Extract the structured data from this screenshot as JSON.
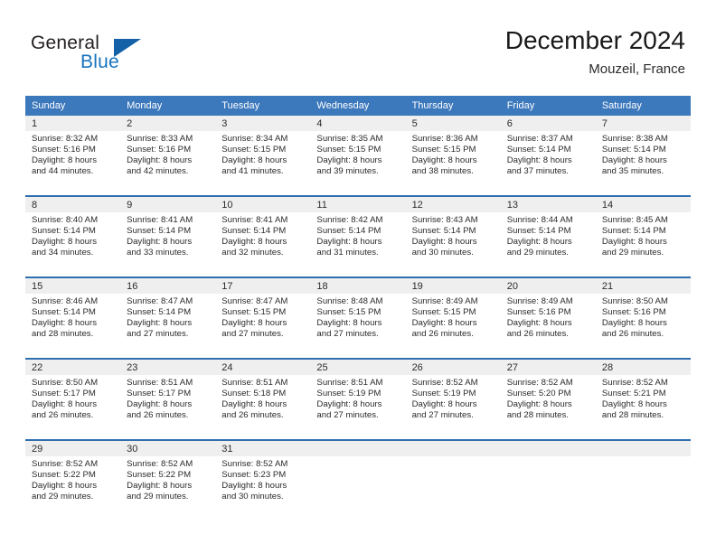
{
  "brand": {
    "name_top": "General",
    "name_bottom": "Blue",
    "accent_color": "#1673bd",
    "triangle_color": "#1461a8"
  },
  "header": {
    "title": "December 2024",
    "subtitle": "Mouzeil, France"
  },
  "calendar": {
    "header_bg": "#3c78bc",
    "row_separator_color": "#2f6fb0",
    "daynum_band_bg": "#efefef",
    "weekday_headers": [
      "Sunday",
      "Monday",
      "Tuesday",
      "Wednesday",
      "Thursday",
      "Friday",
      "Saturday"
    ],
    "weeks": [
      [
        {
          "day": "1",
          "sunrise": "Sunrise: 8:32 AM",
          "sunset": "Sunset: 5:16 PM",
          "daylight1": "Daylight: 8 hours",
          "daylight2": "and 44 minutes."
        },
        {
          "day": "2",
          "sunrise": "Sunrise: 8:33 AM",
          "sunset": "Sunset: 5:16 PM",
          "daylight1": "Daylight: 8 hours",
          "daylight2": "and 42 minutes."
        },
        {
          "day": "3",
          "sunrise": "Sunrise: 8:34 AM",
          "sunset": "Sunset: 5:15 PM",
          "daylight1": "Daylight: 8 hours",
          "daylight2": "and 41 minutes."
        },
        {
          "day": "4",
          "sunrise": "Sunrise: 8:35 AM",
          "sunset": "Sunset: 5:15 PM",
          "daylight1": "Daylight: 8 hours",
          "daylight2": "and 39 minutes."
        },
        {
          "day": "5",
          "sunrise": "Sunrise: 8:36 AM",
          "sunset": "Sunset: 5:15 PM",
          "daylight1": "Daylight: 8 hours",
          "daylight2": "and 38 minutes."
        },
        {
          "day": "6",
          "sunrise": "Sunrise: 8:37 AM",
          "sunset": "Sunset: 5:14 PM",
          "daylight1": "Daylight: 8 hours",
          "daylight2": "and 37 minutes."
        },
        {
          "day": "7",
          "sunrise": "Sunrise: 8:38 AM",
          "sunset": "Sunset: 5:14 PM",
          "daylight1": "Daylight: 8 hours",
          "daylight2": "and 35 minutes."
        }
      ],
      [
        {
          "day": "8",
          "sunrise": "Sunrise: 8:40 AM",
          "sunset": "Sunset: 5:14 PM",
          "daylight1": "Daylight: 8 hours",
          "daylight2": "and 34 minutes."
        },
        {
          "day": "9",
          "sunrise": "Sunrise: 8:41 AM",
          "sunset": "Sunset: 5:14 PM",
          "daylight1": "Daylight: 8 hours",
          "daylight2": "and 33 minutes."
        },
        {
          "day": "10",
          "sunrise": "Sunrise: 8:41 AM",
          "sunset": "Sunset: 5:14 PM",
          "daylight1": "Daylight: 8 hours",
          "daylight2": "and 32 minutes."
        },
        {
          "day": "11",
          "sunrise": "Sunrise: 8:42 AM",
          "sunset": "Sunset: 5:14 PM",
          "daylight1": "Daylight: 8 hours",
          "daylight2": "and 31 minutes."
        },
        {
          "day": "12",
          "sunrise": "Sunrise: 8:43 AM",
          "sunset": "Sunset: 5:14 PM",
          "daylight1": "Daylight: 8 hours",
          "daylight2": "and 30 minutes."
        },
        {
          "day": "13",
          "sunrise": "Sunrise: 8:44 AM",
          "sunset": "Sunset: 5:14 PM",
          "daylight1": "Daylight: 8 hours",
          "daylight2": "and 29 minutes."
        },
        {
          "day": "14",
          "sunrise": "Sunrise: 8:45 AM",
          "sunset": "Sunset: 5:14 PM",
          "daylight1": "Daylight: 8 hours",
          "daylight2": "and 29 minutes."
        }
      ],
      [
        {
          "day": "15",
          "sunrise": "Sunrise: 8:46 AM",
          "sunset": "Sunset: 5:14 PM",
          "daylight1": "Daylight: 8 hours",
          "daylight2": "and 28 minutes."
        },
        {
          "day": "16",
          "sunrise": "Sunrise: 8:47 AM",
          "sunset": "Sunset: 5:14 PM",
          "daylight1": "Daylight: 8 hours",
          "daylight2": "and 27 minutes."
        },
        {
          "day": "17",
          "sunrise": "Sunrise: 8:47 AM",
          "sunset": "Sunset: 5:15 PM",
          "daylight1": "Daylight: 8 hours",
          "daylight2": "and 27 minutes."
        },
        {
          "day": "18",
          "sunrise": "Sunrise: 8:48 AM",
          "sunset": "Sunset: 5:15 PM",
          "daylight1": "Daylight: 8 hours",
          "daylight2": "and 27 minutes."
        },
        {
          "day": "19",
          "sunrise": "Sunrise: 8:49 AM",
          "sunset": "Sunset: 5:15 PM",
          "daylight1": "Daylight: 8 hours",
          "daylight2": "and 26 minutes."
        },
        {
          "day": "20",
          "sunrise": "Sunrise: 8:49 AM",
          "sunset": "Sunset: 5:16 PM",
          "daylight1": "Daylight: 8 hours",
          "daylight2": "and 26 minutes."
        },
        {
          "day": "21",
          "sunrise": "Sunrise: 8:50 AM",
          "sunset": "Sunset: 5:16 PM",
          "daylight1": "Daylight: 8 hours",
          "daylight2": "and 26 minutes."
        }
      ],
      [
        {
          "day": "22",
          "sunrise": "Sunrise: 8:50 AM",
          "sunset": "Sunset: 5:17 PM",
          "daylight1": "Daylight: 8 hours",
          "daylight2": "and 26 minutes."
        },
        {
          "day": "23",
          "sunrise": "Sunrise: 8:51 AM",
          "sunset": "Sunset: 5:17 PM",
          "daylight1": "Daylight: 8 hours",
          "daylight2": "and 26 minutes."
        },
        {
          "day": "24",
          "sunrise": "Sunrise: 8:51 AM",
          "sunset": "Sunset: 5:18 PM",
          "daylight1": "Daylight: 8 hours",
          "daylight2": "and 26 minutes."
        },
        {
          "day": "25",
          "sunrise": "Sunrise: 8:51 AM",
          "sunset": "Sunset: 5:19 PM",
          "daylight1": "Daylight: 8 hours",
          "daylight2": "and 27 minutes."
        },
        {
          "day": "26",
          "sunrise": "Sunrise: 8:52 AM",
          "sunset": "Sunset: 5:19 PM",
          "daylight1": "Daylight: 8 hours",
          "daylight2": "and 27 minutes."
        },
        {
          "day": "27",
          "sunrise": "Sunrise: 8:52 AM",
          "sunset": "Sunset: 5:20 PM",
          "daylight1": "Daylight: 8 hours",
          "daylight2": "and 28 minutes."
        },
        {
          "day": "28",
          "sunrise": "Sunrise: 8:52 AM",
          "sunset": "Sunset: 5:21 PM",
          "daylight1": "Daylight: 8 hours",
          "daylight2": "and 28 minutes."
        }
      ],
      [
        {
          "day": "29",
          "sunrise": "Sunrise: 8:52 AM",
          "sunset": "Sunset: 5:22 PM",
          "daylight1": "Daylight: 8 hours",
          "daylight2": "and 29 minutes."
        },
        {
          "day": "30",
          "sunrise": "Sunrise: 8:52 AM",
          "sunset": "Sunset: 5:22 PM",
          "daylight1": "Daylight: 8 hours",
          "daylight2": "and 29 minutes."
        },
        {
          "day": "31",
          "sunrise": "Sunrise: 8:52 AM",
          "sunset": "Sunset: 5:23 PM",
          "daylight1": "Daylight: 8 hours",
          "daylight2": "and 30 minutes."
        },
        {
          "day": "",
          "sunrise": "",
          "sunset": "",
          "daylight1": "",
          "daylight2": ""
        },
        {
          "day": "",
          "sunrise": "",
          "sunset": "",
          "daylight1": "",
          "daylight2": ""
        },
        {
          "day": "",
          "sunrise": "",
          "sunset": "",
          "daylight1": "",
          "daylight2": ""
        },
        {
          "day": "",
          "sunrise": "",
          "sunset": "",
          "daylight1": "",
          "daylight2": ""
        }
      ]
    ]
  }
}
